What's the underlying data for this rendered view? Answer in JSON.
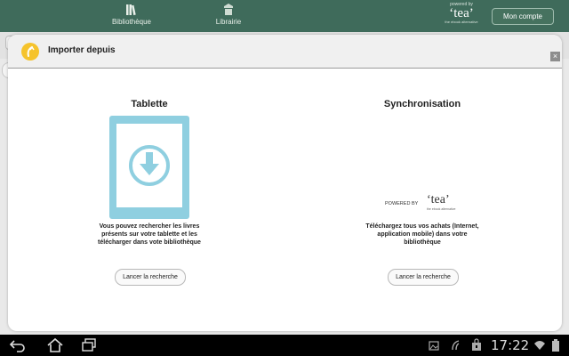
{
  "topbar": {
    "nav": [
      {
        "label": "Bibliothèque",
        "icon": "books-icon"
      },
      {
        "label": "Librairie",
        "icon": "store-icon"
      }
    ],
    "logo": {
      "powered": "powered by",
      "word": "‘tea’",
      "tagline": "the ebook alternative"
    },
    "account_button": "Mon compte"
  },
  "dialog": {
    "title": "Importer depuis",
    "close_label": "×",
    "columns": [
      {
        "title": "Tablette",
        "description": "Vous pouvez rechercher les livres présents sur votre tablette et les télécharger dans vote bibliothèque",
        "button": "Lancer la recherche",
        "illustration": "tablet-download-icon"
      },
      {
        "title": "Synchronisation",
        "powered_by": "POWERED BY",
        "brand": "‘tea’",
        "brand_tagline": "the ebook alternative",
        "description": "Téléchargez tous vos achats (Internet, application mobile) dans votre bibliothèque",
        "button": "Lancer la recherche"
      }
    ]
  },
  "system_bar": {
    "time": "17:22",
    "icons": [
      "back-icon",
      "home-icon",
      "recent-apps-icon",
      "gallery-icon",
      "sync-icon",
      "shopping-icon",
      "wifi-icon",
      "battery-icon"
    ]
  },
  "colors": {
    "topbar": "#3f6b5b",
    "accent_blue": "#8fcfe0",
    "dialog_icon": "#f5c32c"
  }
}
